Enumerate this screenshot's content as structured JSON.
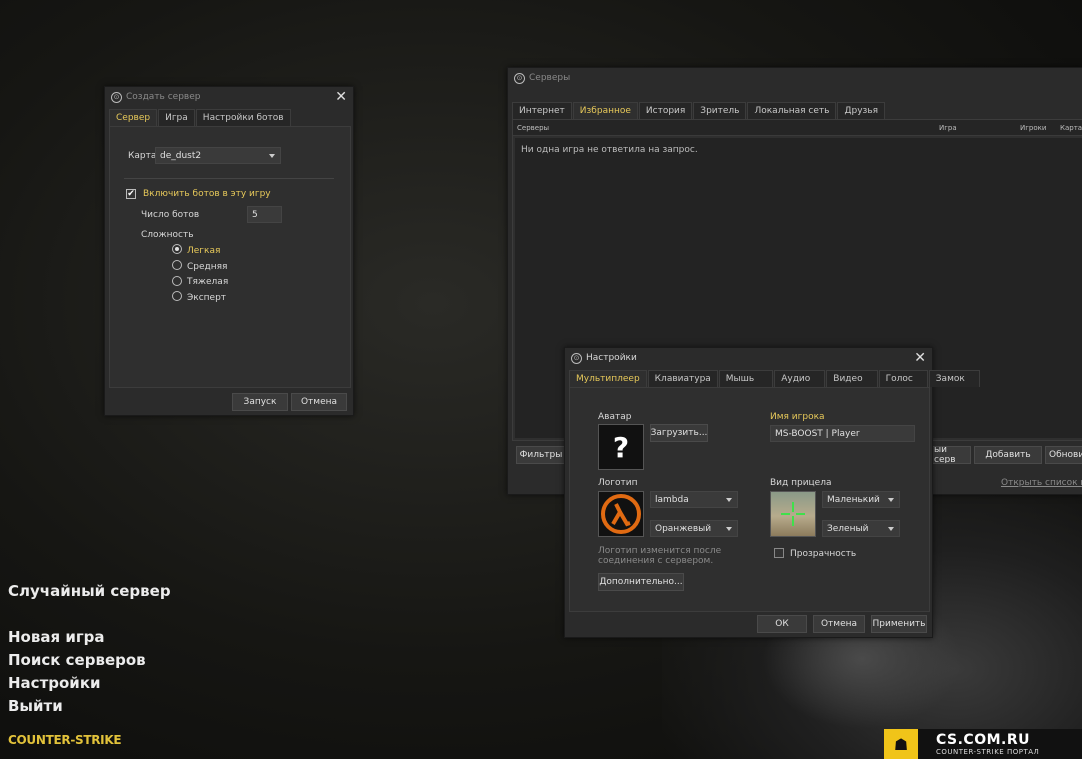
{
  "main_menu": {
    "random_server": "Случайный сервер",
    "new_game": "Новая игра",
    "find_servers": "Поиск серверов",
    "settings": "Настройки",
    "quit": "Выйти"
  },
  "logo_text": "COUNTER-STRIKE",
  "watermark": {
    "site": "CS.COM.RU",
    "tagline": "COUNTER-STRIKE ПОРТАЛ"
  },
  "create_server": {
    "title": "Создать сервер",
    "tabs": [
      "Сервер",
      "Игра",
      "Настройки ботов"
    ],
    "map_label": "Карта",
    "map_value": "de_dust2",
    "enable_bots_label": "Включить ботов в эту игру",
    "bots_count_label": "Число ботов",
    "bots_count_value": "5",
    "difficulty_label": "Сложность",
    "difficulty_options": [
      "Легкая",
      "Средняя",
      "Тяжелая",
      "Эксперт"
    ],
    "start_button": "Запуск",
    "cancel_button": "Отмена"
  },
  "servers": {
    "title": "Серверы",
    "tabs": [
      "Интернет",
      "Избранное",
      "История",
      "Зритель",
      "Локальная сеть",
      "Друзья"
    ],
    "columns": [
      "Серверы",
      "Игра",
      "Игроки",
      "Карта"
    ],
    "empty_message": "Ни одна игра не ответила на запрос.",
    "filters_button": "Фильтры",
    "add_server_partial": "ый серв",
    "add_button": "Добавить",
    "refresh_button": "Обнови",
    "open_list_link": "Открыть список вос"
  },
  "settings": {
    "title": "Настройки",
    "tabs": [
      "Мультиплеер",
      "Клавиатура",
      "Мышь",
      "Аудио",
      "Видео",
      "Голос",
      "Замок"
    ],
    "avatar_label": "Аватар",
    "avatar_placeholder": "?",
    "upload_button": "Загрузить...",
    "player_name_label": "Имя игрока",
    "player_name_value": "MS-BOOST | Player",
    "spray_label": "Логотип",
    "spray_value": "lambda",
    "spray_color": "Оранжевый",
    "spray_note": "Логотип изменится после соединения с сервером.",
    "advanced_button": "Дополнительно...",
    "crosshair_label": "Вид прицела",
    "crosshair_size": "Маленький",
    "crosshair_color": "Зеленый",
    "transparency_label": "Прозрачность",
    "ok_button": "ОК",
    "cancel_button": "Отмена",
    "apply_button": "Применить"
  }
}
